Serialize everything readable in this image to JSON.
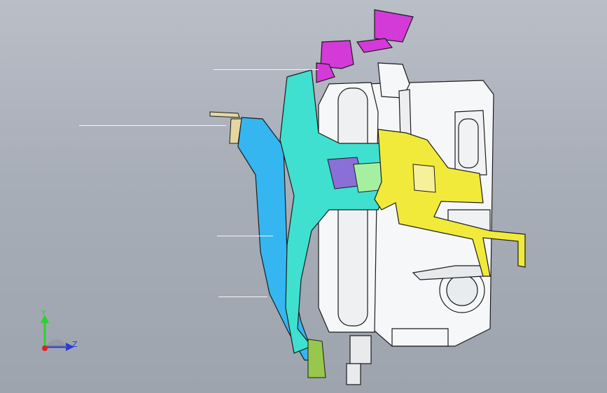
{
  "viewport": {
    "background_top": "#b9bec7",
    "background_bottom": "#9ea4ae"
  },
  "colors": {
    "bracket_cyan": "#3fe0cf",
    "bracket_blue": "#35b6f0",
    "mount_magenta": "#d43ad8",
    "bracket_yellow": "#f1ea3a",
    "housing_white": "#f6f7f8",
    "edge_dark": "#1c1c1c",
    "axis_y": "#2fd02f",
    "axis_z": "#2b3bd6",
    "origin_red": "#e02222"
  },
  "triad": {
    "y_label": "Y",
    "z_label": "Z"
  },
  "parts": [
    {
      "name": "upper-mount-magenta-icon"
    },
    {
      "name": "cyan-bracket-icon"
    },
    {
      "name": "blue-rail-icon"
    },
    {
      "name": "yellow-support-icon"
    },
    {
      "name": "gear-housing-icon"
    }
  ]
}
